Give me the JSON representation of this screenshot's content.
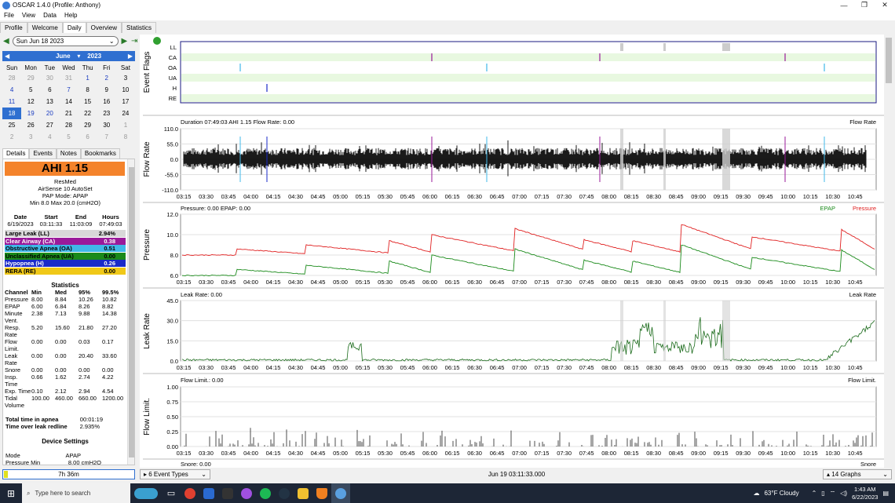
{
  "window": {
    "title": "OSCAR 1.4.0 (Profile: Anthony)",
    "minimize": "—",
    "restore": "❐",
    "close": "✕"
  },
  "menu": [
    "File",
    "View",
    "Data",
    "Help"
  ],
  "tabs": [
    "Profile",
    "Welcome",
    "Daily",
    "Overview",
    "Statistics"
  ],
  "datenav": {
    "date": "Sun Jun 18 2023"
  },
  "calendar": {
    "month": "June",
    "year": "2023",
    "day_names": [
      "Sun",
      "Mon",
      "Tue",
      "Wed",
      "Thu",
      "Fri",
      "Sat"
    ],
    "weeks": [
      [
        "28",
        "29",
        "30",
        "31",
        "1",
        "2",
        "3"
      ],
      [
        "4",
        "5",
        "6",
        "7",
        "8",
        "9",
        "10"
      ],
      [
        "11",
        "12",
        "13",
        "14",
        "15",
        "16",
        "17"
      ],
      [
        "18",
        "19",
        "20",
        "21",
        "22",
        "23",
        "24"
      ],
      [
        "25",
        "26",
        "27",
        "28",
        "29",
        "30",
        "1"
      ],
      [
        "2",
        "3",
        "4",
        "5",
        "6",
        "7",
        "8"
      ]
    ],
    "selected": "18"
  },
  "side_tabs": [
    "Details",
    "Events",
    "Notes",
    "Bookmarks"
  ],
  "details": {
    "ahi": "AHI 1.15",
    "brand": "ResMed",
    "model": "AirSense 10 AutoSet",
    "mode": "PAP Mode: APAP",
    "pressure": "Min 8.0 Max 20.0 (cmH2O)",
    "session_headers": [
      "Date",
      "Start",
      "End",
      "Hours"
    ],
    "session_values": [
      "6/19/2023",
      "03:11:33",
      "11:03:09",
      "07:49:03"
    ],
    "events": [
      {
        "label": "Large Leak (LL)",
        "value": "2.94%",
        "color": "#d8d8d8",
        "text": "#000000"
      },
      {
        "label": "Clear Airway (CA)",
        "value": "0.38",
        "color": "#9a1a9a",
        "text": "#ffffff"
      },
      {
        "label": "Obstructive Apnea (OA)",
        "value": "0.51",
        "color": "#40b8e8",
        "text": "#000000"
      },
      {
        "label": "Unclassified Apnea (UA)",
        "value": "0.00",
        "color": "#1a8a1a",
        "text": "#000000"
      },
      {
        "label": "Hypopnea (H)",
        "value": "0.26",
        "color": "#1a2ac8",
        "text": "#ffffff"
      },
      {
        "label": "RERA (RE)",
        "value": "0.00",
        "color": "#f0c818",
        "text": "#000000"
      }
    ],
    "stats_title": "Statistics",
    "stats_headers": [
      "Channel",
      "Min",
      "Med",
      "95%",
      "99.5%"
    ],
    "stats_rows": [
      [
        "Pressure",
        "8.00",
        "8.84",
        "10.26",
        "10.82"
      ],
      [
        "EPAP",
        "6.00",
        "6.84",
        "8.26",
        "8.82"
      ],
      [
        "Minute Vent.",
        "2.38",
        "7.13",
        "9.88",
        "14.38"
      ],
      [
        "Resp. Rate",
        "5.20",
        "15.60",
        "21.80",
        "27.20"
      ],
      [
        "Flow Limit.",
        "0.00",
        "0.00",
        "0.03",
        "0.17"
      ],
      [
        "Leak Rate",
        "0.00",
        "0.00",
        "20.40",
        "33.60"
      ],
      [
        "Snore",
        "0.00",
        "0.00",
        "0.00",
        "0.00"
      ],
      [
        "Insp. Time",
        "0.66",
        "1.62",
        "2.74",
        "4.22"
      ],
      [
        "Exp. Time",
        "0.10",
        "2.12",
        "2.94",
        "4.54"
      ],
      [
        "Tidal Volume",
        "100.00",
        "460.00",
        "660.00",
        "1200.00"
      ]
    ],
    "apnea_label": "Total time in apnea",
    "apnea_value": "00:01:19",
    "redline_label": "Time over leak redline",
    "redline_value": "2.935%",
    "device_title": "Device Settings",
    "mode_label": "Mode",
    "mode_value": "APAP",
    "pmin_label": "Pressure Min",
    "pmin_value": "8.00 cmH2O"
  },
  "bottom_left": "7h 36m",
  "time_ticks": [
    "03:15",
    "03:30",
    "03:45",
    "04:00",
    "04:15",
    "04:30",
    "04:45",
    "05:00",
    "05:15",
    "05:30",
    "05:45",
    "06:00",
    "06:15",
    "06:30",
    "06:45",
    "07:00",
    "07:15",
    "07:30",
    "07:45",
    "08:00",
    "08:15",
    "08:30",
    "08:45",
    "09:00",
    "09:15",
    "09:30",
    "09:45",
    "10:00",
    "10:15",
    "10:30",
    "10:45"
  ],
  "graphs": {
    "event_flags": {
      "ylabel": "Event Flags",
      "rows": [
        "LL",
        "CA",
        "OA",
        "UA",
        "H",
        "RE"
      ]
    },
    "flow": {
      "ylabel": "Flow Rate",
      "header": "Duration 07:49:03 AHI 1.15 Flow Rate: 0.00",
      "legend": "Flow Rate",
      "ticks": [
        "110.0",
        "55.0",
        "0.0",
        "-55.0",
        "-110.0"
      ]
    },
    "pressure": {
      "ylabel": "Pressure",
      "header": "Pressure: 0.00 EPAP: 0.00",
      "legend_epap": "EPAP",
      "legend_pressure": "Pressure",
      "ticks": [
        "12.0",
        "10.0",
        "8.0",
        "6.0"
      ]
    },
    "leak": {
      "ylabel": "Leak Rate",
      "header": "Leak Rate: 0.00",
      "legend": "Leak Rate",
      "ticks": [
        "45.0",
        "30.0",
        "15.0",
        "0.0"
      ]
    },
    "flowlimit": {
      "ylabel": "Flow Limit.",
      "header": "Flow Limit.: 0.00",
      "legend": "Flow Limit.",
      "ticks": [
        "1.00",
        "0.75",
        "0.50",
        "0.25",
        "0.00"
      ]
    },
    "snore": {
      "header": "Snore: 0.00",
      "legend": "Snore"
    }
  },
  "toolbar": {
    "event_types": "6 Event Types",
    "time": "Jun 19 03:11:33.000",
    "graphs": "14 Graphs"
  },
  "taskbar": {
    "search_placeholder": "Type here to search",
    "weather": "63°F  Cloudy",
    "time": "1:43 AM",
    "date": "6/22/2023"
  },
  "colors": {
    "accent": "#2f6fd0",
    "ahi": "#f4832b",
    "epap": "#1a8a1a",
    "pressure": "#e02020",
    "flag_bg": "#e8f8e0"
  }
}
